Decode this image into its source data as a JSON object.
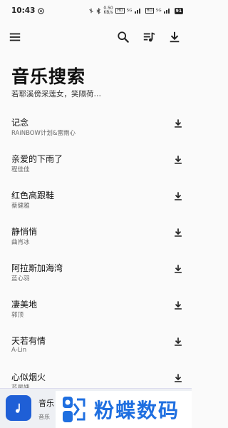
{
  "status_bar": {
    "time": "10:43",
    "net_speed": "0.50 KB/s",
    "network_labels": [
      "HD",
      "5G",
      "HD",
      "5G"
    ],
    "battery": "91"
  },
  "toolbar": {
    "menu_icon": "menu-icon",
    "search_icon": "search-icon",
    "playlist_icon": "playlist-icon",
    "download_icon": "download-icon"
  },
  "header": {
    "title": "音乐搜索",
    "subtitle": "若耶溪傍采莲女，笑隔荷…"
  },
  "songs": [
    {
      "title": "记念",
      "artist": "RAiNBOW计划&雷雨心"
    },
    {
      "title": "亲爱的下雨了",
      "artist": "程佳佳"
    },
    {
      "title": "红色高跟鞋",
      "artist": "蔡健雅"
    },
    {
      "title": "静悄悄",
      "artist": "曲肖冰"
    },
    {
      "title": "阿拉斯加海湾",
      "artist": "蓝心羽"
    },
    {
      "title": "凄美地",
      "artist": "郭顶"
    },
    {
      "title": "天若有情",
      "artist": "A-Lin"
    },
    {
      "title": "心似烟火",
      "artist": "苏星婕"
    }
  ],
  "player": {
    "title": "音乐",
    "subtitle": "音乐"
  },
  "watermark": {
    "text": "粉蝶数码"
  },
  "colors": {
    "accent": "#1f5fd6",
    "watermark": "#1f6fe0",
    "background": "#fafafa"
  }
}
